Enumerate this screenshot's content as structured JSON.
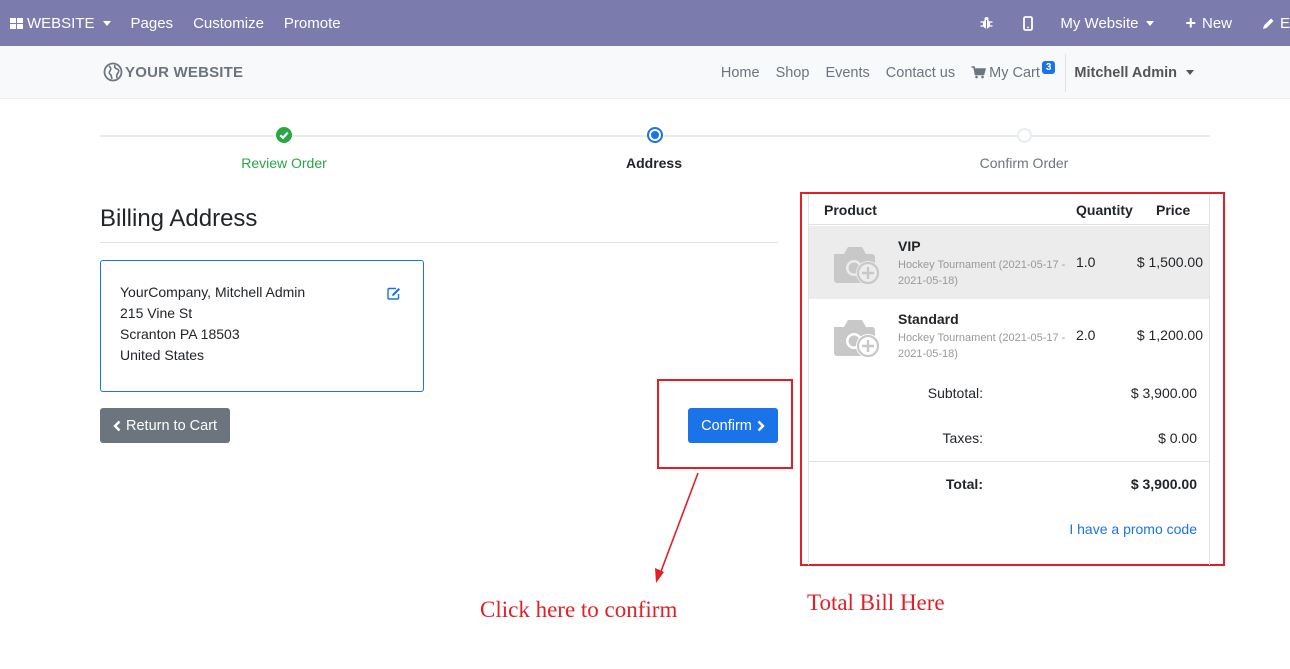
{
  "admin_bar": {
    "website_menu": "WEBSITE",
    "pages": "Pages",
    "customize": "Customize",
    "promote": "Promote",
    "website_switcher": "My Website",
    "new": "New",
    "edit": "Edit"
  },
  "header": {
    "logo": "YOUR WEBSITE",
    "nav": [
      "Home",
      "Shop",
      "Events",
      "Contact us"
    ],
    "cart_label": "My Cart",
    "cart_count": "3",
    "user": "Mitchell Admin"
  },
  "wizard": {
    "steps": [
      {
        "label": "Review Order",
        "state": "done"
      },
      {
        "label": "Address",
        "state": "active"
      },
      {
        "label": "Confirm Order",
        "state": "pending"
      }
    ]
  },
  "billing": {
    "title": "Billing Address",
    "address_lines": [
      "YourCompany, Mitchell Admin",
      "215 Vine St",
      "Scranton PA 18503",
      "United States"
    ]
  },
  "buttons": {
    "return_to_cart": "Return to Cart",
    "confirm": "Confirm"
  },
  "annotations": {
    "confirm_hint": "Click here to confirm",
    "bill_hint": "Total Bill Here"
  },
  "cart": {
    "headers": {
      "product": "Product",
      "quantity": "Quantity",
      "price": "Price"
    },
    "lines": [
      {
        "name": "VIP",
        "description": "Hockey Tournament (2021-05-17 - 2021-05-18)",
        "quantity": "1.0",
        "price": "$ 1,500.00"
      },
      {
        "name": "Standard",
        "description": "Hockey Tournament (2021-05-17 - 2021-05-18)",
        "quantity": "2.0",
        "price": "$ 1,200.00"
      }
    ],
    "subtotal_label": "Subtotal:",
    "subtotal": "$ 3,900.00",
    "taxes_label": "Taxes:",
    "taxes": "$ 0.00",
    "total_label": "Total:",
    "total": "$ 3,900.00",
    "promo_link": "I have a promo code"
  },
  "colors": {
    "admin_bar": "#7c7bad",
    "primary": "#1a73e8",
    "success": "#28a745",
    "annotation_red": "#e31f26"
  }
}
